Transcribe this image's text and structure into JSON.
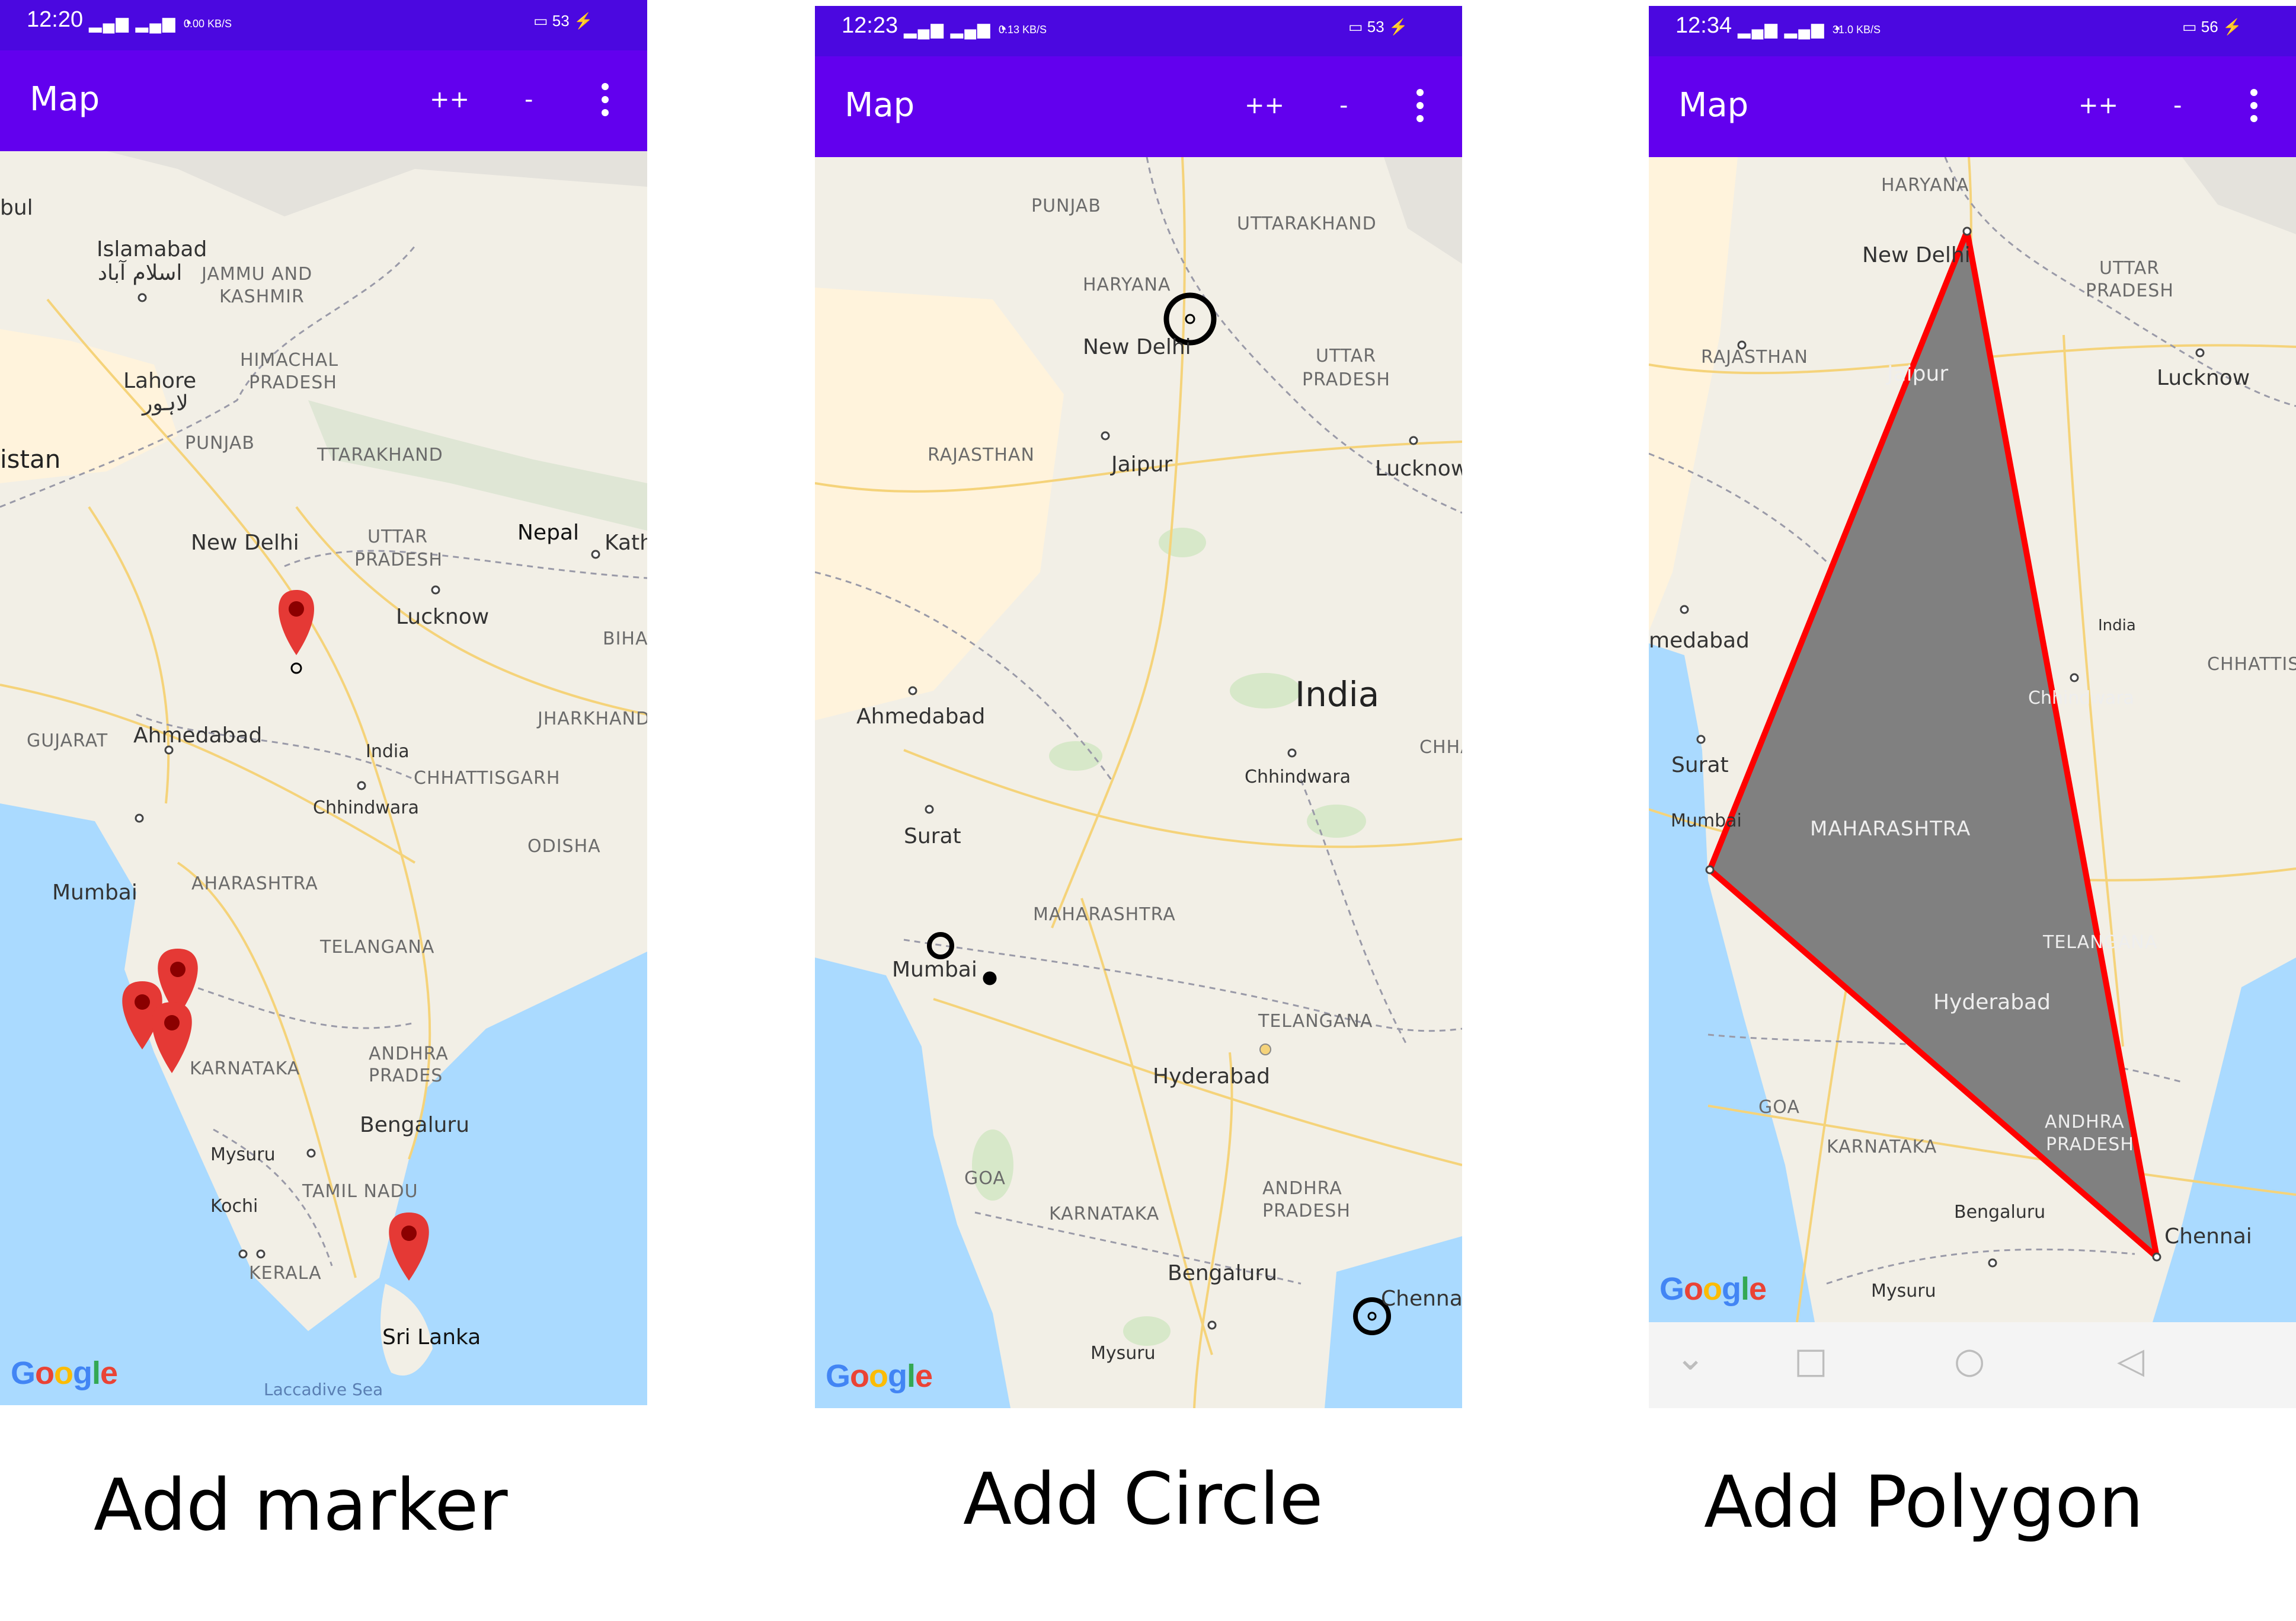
{
  "panels": [
    {
      "status": {
        "time": "12:20",
        "speed": "0.00 KB/S",
        "battery": "53"
      },
      "appbar": {
        "title": "Map",
        "zoom_in_label": "++",
        "zoom_out_label": "-"
      },
      "labels": {
        "islamabad": "Islamabad",
        "islamabad_ur": "اسلام آباد",
        "jammu": "JAMMU AND",
        "kashmir": "KASHMIR",
        "himachal": "HIMACHAL",
        "pradesh": "PRADESH",
        "lahore": "Lahore",
        "lahore_ur": "لاہور",
        "kabul": "bul",
        "pakistan": "istan",
        "punjab": "PUNJAB",
        "uttarakhand": "TTARAKHAND",
        "new_delhi": "New Delhi",
        "uttar": "UTTAR",
        "uttar_pradesh": "PRADESH",
        "nepal": "Nepal",
        "kathmandu": "Kath",
        "lucknow": "Lucknow",
        "bihar": "BIHAR",
        "gujarat": "GUJARAT",
        "ahmedabad": "Ahmedabad",
        "india": "India",
        "jharkhand": "JHARKHAND",
        "chhattisgarh": "CHHATTISGARH",
        "chhindwara": "Chhindwara",
        "odisha": "ODISHA",
        "mumbai": "Mumbai",
        "maharashtra": "AHARASHTRA",
        "telangana": "TELANGANA",
        "karnataka": "KARNATAKA",
        "andhra": "ANDHRA",
        "andhra_pradesh": "PRADES",
        "bengaluru": "Bengaluru",
        "mysuru": "Mysuru",
        "tamil_nadu": "TAMIL NADU",
        "kochi": "Kochi",
        "kerala": "KERALA",
        "sri_lanka": "Sri Lanka",
        "laccadive": "Laccadive Sea"
      },
      "caption": "Add marker"
    },
    {
      "status": {
        "time": "12:23",
        "speed": "0.13 KB/S",
        "battery": "53"
      },
      "appbar": {
        "title": "Map",
        "zoom_in_label": "++",
        "zoom_out_label": "-"
      },
      "labels": {
        "punjab": "PUNJAB",
        "uttarakhand": "UTTARAKHAND",
        "haryana": "HARYANA",
        "new_delhi": "New Delhi",
        "uttar": "UTTAR",
        "uttar_pradesh": "PRADESH",
        "rajasthan": "RAJASTHAN",
        "jaipur": "Jaipur",
        "lucknow": "Lucknow",
        "india": "India",
        "ahmedabad": "Ahmedabad",
        "chhindwara": "Chhindwara",
        "chha": "CHHA",
        "surat": "Surat",
        "maharashtra": "MAHARASHTRA",
        "mumbai": "Mumbai",
        "telangana": "TELANGANA",
        "hyderabad": "Hyderabad",
        "goa": "GOA",
        "karnataka": "KARNATAKA",
        "andhra": "ANDHRA",
        "andhra_pradesh": "PRADESH",
        "bengaluru": "Bengaluru",
        "chennai": "Chennai",
        "mysuru": "Mysuru"
      },
      "caption": "Add Circle"
    },
    {
      "status": {
        "time": "12:34",
        "speed": "31.0 KB/S",
        "battery": "56"
      },
      "appbar": {
        "title": "Map",
        "zoom_in_label": "++",
        "zoom_out_label": "-"
      },
      "labels": {
        "haryana": "HARYANA",
        "new_delhi": "New Delhi",
        "uttar": "UTTAR",
        "uttar_pradesh": "PRADESH",
        "rajasthan": "RAJASTHAN",
        "jaipur": "Jaipur",
        "lucknow": "Lucknow",
        "ahmedabad": "medabad",
        "india": "India",
        "chhattis": "CHHATTIS",
        "chhindwara": "Chhindwara",
        "surat": "Surat",
        "mumbai": "Mumbai",
        "maharashtra": "MAHARASHTRA",
        "telangana": "TELANGANA",
        "hyderabad": "Hyderabad",
        "goa": "GOA",
        "karnataka": "KARNATAKA",
        "andhra": "ANDHRA",
        "andhra_pradesh": "PRADESH",
        "bengaluru": "Bengaluru",
        "chennai": "Chennai",
        "mysuru": "Mysuru"
      },
      "caption": "Add Polygon"
    }
  ],
  "google_logo": [
    "G",
    "o",
    "o",
    "g",
    "l",
    "e"
  ],
  "colors": {
    "statusbar": "#4b08e0",
    "appbar": "#6200ee",
    "land": "#f2efe6",
    "water": "#aadaff",
    "marker": "#e53935",
    "polygon_fill": "#808080",
    "polygon_stroke": "#ff0000"
  }
}
